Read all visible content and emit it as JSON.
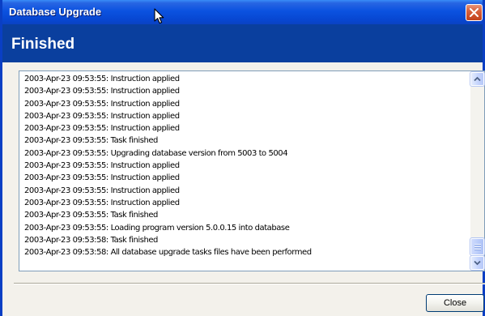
{
  "window": {
    "title": "Database Upgrade",
    "header_title": "Finished"
  },
  "log": {
    "lines": [
      "2003-Apr-23 09:53:55: Instruction applied",
      "2003-Apr-23 09:53:55: Instruction applied",
      "2003-Apr-23 09:53:55: Instruction applied",
      "2003-Apr-23 09:53:55: Instruction applied",
      "2003-Apr-23 09:53:55: Instruction applied",
      "2003-Apr-23 09:53:55: Task finished",
      "2003-Apr-23 09:53:55: Upgrading database version from 5003 to 5004",
      "2003-Apr-23 09:53:55: Instruction applied",
      "2003-Apr-23 09:53:55: Instruction applied",
      "2003-Apr-23 09:53:55: Instruction applied",
      "2003-Apr-23 09:53:55: Instruction applied",
      "2003-Apr-23 09:53:55: Task finished",
      "2003-Apr-23 09:53:55: Loading program version 5.0.0.15 into database",
      "2003-Apr-23 09:53:58: Task finished",
      "2003-Apr-23 09:53:58: All database upgrade tasks files have been performed"
    ]
  },
  "buttons": {
    "close_label": "Close"
  },
  "icons": {
    "title_close": "close-x-icon",
    "scroll_up": "scroll-up-arrow-icon",
    "scroll_down": "scroll-down-arrow-icon",
    "cursor": "mouse-pointer-icon"
  },
  "colors": {
    "title_bar": "#0b52e0",
    "header_band": "#0a3f9e",
    "close_button": "#d7603c",
    "dialog_background": "#f3f1eb"
  }
}
